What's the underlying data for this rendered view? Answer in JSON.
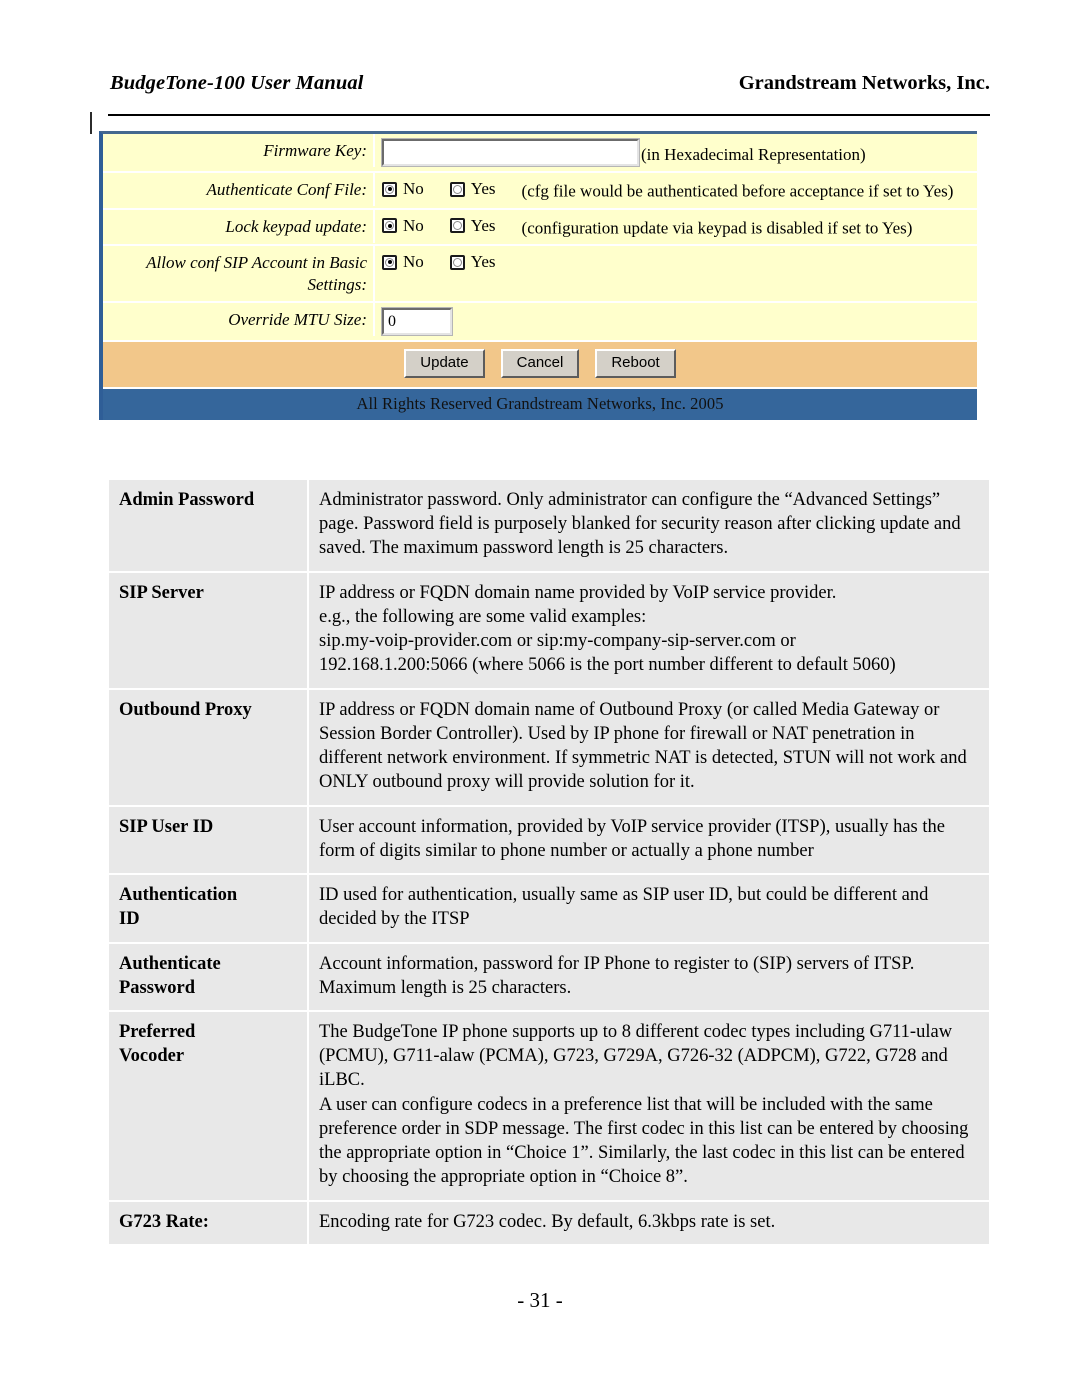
{
  "header": {
    "left_title": "BudgeTone-100 User Manual",
    "right_title": "Grandstream Networks, Inc."
  },
  "config_panel": {
    "rows": [
      {
        "label": "Firmware Key:",
        "input_value": "",
        "note": "(in Hexadecimal Representation)"
      },
      {
        "label": "Authenticate Conf File:",
        "option_no": "No",
        "option_yes": "Yes",
        "selected": "No",
        "note": "(cfg file would be authenticated before acceptance if set to Yes)"
      },
      {
        "label": "Lock keypad update:",
        "option_no": "No",
        "option_yes": "Yes",
        "selected": "No",
        "note": "(configuration update via keypad is disabled if set to Yes)"
      },
      {
        "label_line1": "Allow conf SIP Account",
        "label_line2": "in Basic Settings:",
        "option_no": "No",
        "option_yes": "Yes",
        "selected": "No",
        "note": ""
      },
      {
        "label": "Override MTU Size:",
        "input_value": "0"
      }
    ],
    "buttons": {
      "update": "Update",
      "cancel": "Cancel",
      "reboot": "Reboot"
    },
    "footer": "All Rights Reserved Grandstream Networks, Inc. 2005",
    "colors": {
      "field_background": "#ffffcc",
      "button_bar": "#f2c78a",
      "footer_bar": "#35669b",
      "panel_border": "#2f5e97"
    }
  },
  "definitions": [
    {
      "term": "Admin Password",
      "term_line2": "",
      "description": "Administrator password. Only administrator can configure the “Advanced Settings” page. Password field is purposely blanked for security reason after clicking update and saved. The maximum password length is 25 characters."
    },
    {
      "term": "SIP Server",
      "term_line2": "",
      "line1": "IP address or FQDN domain name provided by VoIP service provider.",
      "line2": "e.g., the following are some valid examples:",
      "line3": "sip.my-voip-provider.com  or sip:my-company-sip-server.com   or",
      "line4": "192.168.1.200:5066 (where 5066 is the port number different to default 5060)"
    },
    {
      "term": "Outbound Proxy",
      "term_line2": "",
      "description": "IP address or FQDN domain name of Outbound Proxy (or called Media Gateway or Session Border Controller). Used by IP phone for firewall or NAT penetration in different network environment. If symmetric NAT is detected, STUN will not work and ONLY outbound proxy will provide solution for it."
    },
    {
      "term": "SIP User ID",
      "term_line2": "",
      "description": "User account information, provided by VoIP service provider (ITSP), usually has the form of digits similar to phone number or actually a phone number"
    },
    {
      "term": "Authentication",
      "term_line2": "ID",
      "description": "ID used for authentication, usually same as SIP user ID, but could be different and decided by the ITSP"
    },
    {
      "term": "Authenticate",
      "term_line2": "Password",
      "description": "Account information, password for IP Phone to register to (SIP) servers of ITSP. Maximum length is 25 characters."
    },
    {
      "term": "Preferred",
      "term_line2": "Vocoder",
      "para1": "The BudgeTone IP phone supports up to 8 different codec types including G711-ulaw (PCMU), G711-alaw (PCMA), G723, G729A, G726-32 (ADPCM), G722, G728 and iLBC.",
      "para2": "A user can configure codecs in a preference list that will be included with the same preference order in SDP message. The first codec in this list can be entered by choosing the appropriate option in “Choice 1”. Similarly, the last codec in this list can be entered by choosing the appropriate option in “Choice 8”."
    },
    {
      "term": "G723 Rate:",
      "term_line2": "",
      "description": "Encoding rate for G723 codec. By default, 6.3kbps rate is set."
    }
  ],
  "page_number": "- 31 -"
}
